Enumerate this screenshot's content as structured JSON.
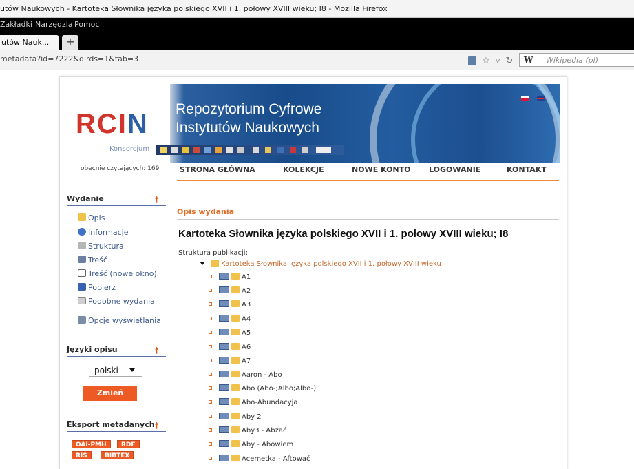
{
  "browser": {
    "title": "utów Naukowych - Kartoteka Słownika języka polskiego XVII i 1. połowy XVIII wieku; I8 - Mozilla Firefox",
    "menu": [
      "Zakładki",
      "Narzędzia",
      "Pomoc"
    ],
    "tab_label": "utów Nauk...",
    "new_tab": "+",
    "url": "metadata?id=7222&dirds=1&tab=3",
    "search_engine": "W",
    "search_placeholder": "Wikipedia (pl)"
  },
  "banner": {
    "logo_r": "RC",
    "logo_i": "I",
    "logo_n": "N",
    "konsorcjum": "Konsorcjum",
    "title_line1": "Repozytorium Cyfrowe",
    "title_line2": "Instytutów Naukowych"
  },
  "header": {
    "readers": "obecnie czytających: 169",
    "nav": [
      "STRONA GŁÓWNA",
      "KOLEKCJE",
      "NOWE KONTO",
      "LOGOWANIE",
      "KONTAKT"
    ]
  },
  "sidebar": {
    "wydanie_title": "Wydanie",
    "items": [
      "Opis",
      "Informacje",
      "Struktura",
      "Treść",
      "Treść (nowe okno)",
      "Pobierz",
      "Podobne wydania",
      "Opcje wyświetlania"
    ],
    "jezyki_title": "Języki opisu",
    "lang_value": "polski",
    "change_button": "Zmień",
    "export_title": "Eksport metadanych",
    "export": [
      "OAI-PMH",
      "RDF",
      "RIS",
      "BIBTEX"
    ]
  },
  "content": {
    "section_title": "Opis wydania",
    "title": "Kartoteka Słownika języka polskiego XVII i 1. połowy XVIII wieku; I8",
    "structure_label": "Struktura publikacji:",
    "root_item": "Kartoteka Słownika języka polskiego XVII i 1. połowy XVIII wieku",
    "items": [
      "A1",
      "A2",
      "A3",
      "A4",
      "A5",
      "A6",
      "A7",
      "Aaron - Abo",
      "Abo (Abo-;Albo;Albo-)",
      "Abo-Abundacyja",
      "Aby 2",
      "Aby3 - Abzać",
      "Aby - Abowiem",
      "Acemetka - Aftować"
    ]
  }
}
